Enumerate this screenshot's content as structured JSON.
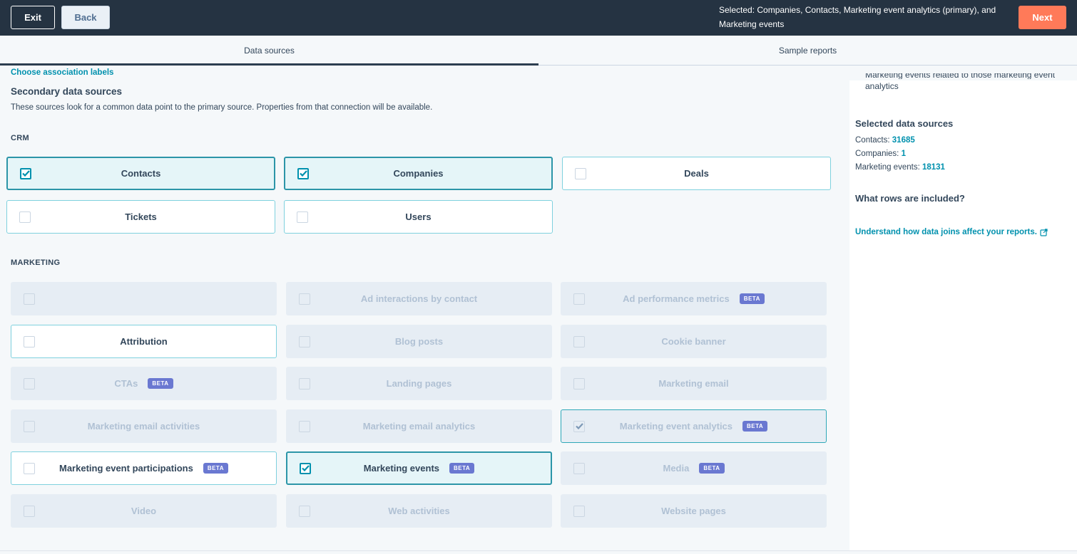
{
  "header": {
    "exit_label": "Exit",
    "back_label": "Back",
    "selected_summary": "Selected: Companies, Contacts, Marketing event analytics (primary), and Marketing events",
    "next_label": "Next"
  },
  "tabs": [
    {
      "label": "Data sources",
      "active": true
    },
    {
      "label": "Sample reports",
      "active": false
    }
  ],
  "main": {
    "association_link": "Choose association labels",
    "section_title": "Secondary data sources",
    "section_description": "These sources look for a common data point to the primary source. Properties from that connection will be available.",
    "crm_label": "CRM",
    "marketing_label": "MARKETING",
    "beta_label": "BETA",
    "crm_sources": [
      {
        "label": "Contacts",
        "state": "checked"
      },
      {
        "label": "Companies",
        "state": "checked"
      },
      {
        "label": "Deals",
        "state": "enabled"
      },
      {
        "label": "Tickets",
        "state": "enabled"
      },
      {
        "label": "Users",
        "state": "enabled"
      }
    ],
    "marketing_sources": [
      {
        "label": "",
        "state": "disabled",
        "beta": false
      },
      {
        "label": "Ad interactions by contact",
        "state": "disabled",
        "beta": false
      },
      {
        "label": "Ad performance metrics",
        "state": "disabled",
        "beta": true
      },
      {
        "label": "Attribution",
        "state": "enabled",
        "beta": false
      },
      {
        "label": "Blog posts",
        "state": "disabled",
        "beta": false
      },
      {
        "label": "Cookie banner",
        "state": "disabled",
        "beta": false
      },
      {
        "label": "CTAs",
        "state": "disabled",
        "beta": true
      },
      {
        "label": "Landing pages",
        "state": "disabled",
        "beta": false
      },
      {
        "label": "Marketing email",
        "state": "disabled",
        "beta": false
      },
      {
        "label": "Marketing email activities",
        "state": "disabled",
        "beta": false
      },
      {
        "label": "Marketing email analytics",
        "state": "disabled",
        "beta": false
      },
      {
        "label": "Marketing event analytics",
        "state": "disabled-checked",
        "beta": true
      },
      {
        "label": "Marketing event participations",
        "state": "enabled",
        "beta": true
      },
      {
        "label": "Marketing events",
        "state": "checked",
        "beta": true
      },
      {
        "label": "Media",
        "state": "disabled",
        "beta": true
      },
      {
        "label": "Video",
        "state": "disabled",
        "beta": false
      },
      {
        "label": "Web activities",
        "state": "disabled",
        "beta": false
      },
      {
        "label": "Website pages",
        "state": "disabled",
        "beta": false
      }
    ]
  },
  "right_panel": {
    "cut_text_line1": "Marketing events related to those marketing event",
    "cut_text_line2": "analytics",
    "selected_heading": "Selected data sources",
    "selected_counts": [
      {
        "label": "Contacts: ",
        "value": "31685"
      },
      {
        "label": "Companies: ",
        "value": "1"
      },
      {
        "label": "Marketing events: ",
        "value": "18131"
      }
    ],
    "rows_heading": "What rows are included?",
    "joins_link": "Understand how data joins affect your reports."
  }
}
